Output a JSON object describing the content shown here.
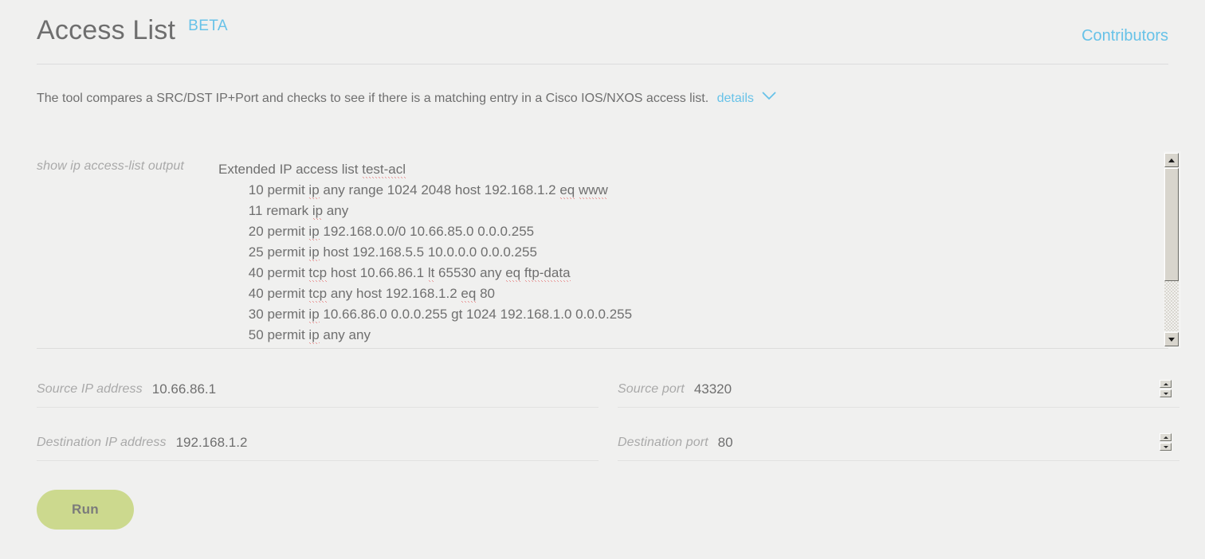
{
  "header": {
    "title": "Access List",
    "badge": "BETA",
    "contributors_label": "Contributors"
  },
  "description": {
    "text": "The tool compares a SRC/DST IP+Port and checks to see if there is a matching entry in a Cisco IOS/NXOS access list.",
    "details_label": "details",
    "chevron_icon": "chevron-down-icon"
  },
  "acl": {
    "label": "show ip access-list output",
    "lines": [
      "Extended IP access list test-acl",
      "        10 permit ip any range 1024 2048 host 192.168.1.2 eq www",
      "        11 remark ip any",
      "        20 permit ip 192.168.0.0/0 10.66.85.0 0.0.0.255",
      "        25 permit ip host 192.168.5.5 10.0.0.0 0.0.0.255",
      "        40 permit tcp host 10.66.86.1 lt 65530 any eq ftp-data",
      "        40 permit tcp any host 192.168.1.2 eq 80",
      "        30 permit ip 10.66.86.0 0.0.0.255 gt 1024 192.168.1.0 0.0.0.255",
      "        50 permit ip any any"
    ],
    "scrollbar": {
      "up_icon": "scroll-up-arrow-icon",
      "down_icon": "scroll-down-arrow-icon"
    }
  },
  "fields": {
    "source_ip": {
      "label": "Source IP address",
      "value": "10.66.86.1",
      "placeholder": "Source IP address"
    },
    "source_port": {
      "label": "Source port",
      "value": "43320",
      "placeholder": "Source port"
    },
    "destination_ip": {
      "label": "Destination IP address",
      "value": "192.168.1.2",
      "placeholder": "Destination IP address"
    },
    "destination_port": {
      "label": "Destination port",
      "value": "80",
      "placeholder": "Destination port"
    },
    "spinner": {
      "up_icon": "spinner-up-icon",
      "down_icon": "spinner-down-icon"
    }
  },
  "actions": {
    "run_label": "Run"
  },
  "colors": {
    "page_background": "#f0f0ef",
    "accent_blue": "#67c2e8",
    "run_button": "#ccd98e",
    "text": "#6f6f6f",
    "placeholder": "#a9a9a9",
    "divider": "#dcdcdc",
    "spellcheck_underline": "#e03131"
  }
}
